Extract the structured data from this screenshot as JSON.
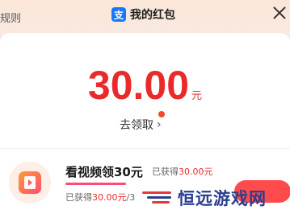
{
  "header": {
    "rules_label": "规则",
    "title": "我的红包",
    "app_icon_glyph": "支"
  },
  "balance": {
    "amount": "30.00",
    "unit": "元",
    "goto_label": "去领取",
    "goto_arrow": "›"
  },
  "task": {
    "title": "看视频领30元",
    "earned_prefix": "已获得",
    "earned_amount": "30.00元",
    "progress_prefix": "已获得",
    "progress_amount": "30.00元",
    "progress_suffix": "/3",
    "progress_fraction": 1.0
  },
  "watermark": {
    "text": "恒远游戏网"
  },
  "colors": {
    "accent_red": "#ea2a2a",
    "brand_blue": "#1677ff",
    "progress_pink": "#ff4a74"
  }
}
